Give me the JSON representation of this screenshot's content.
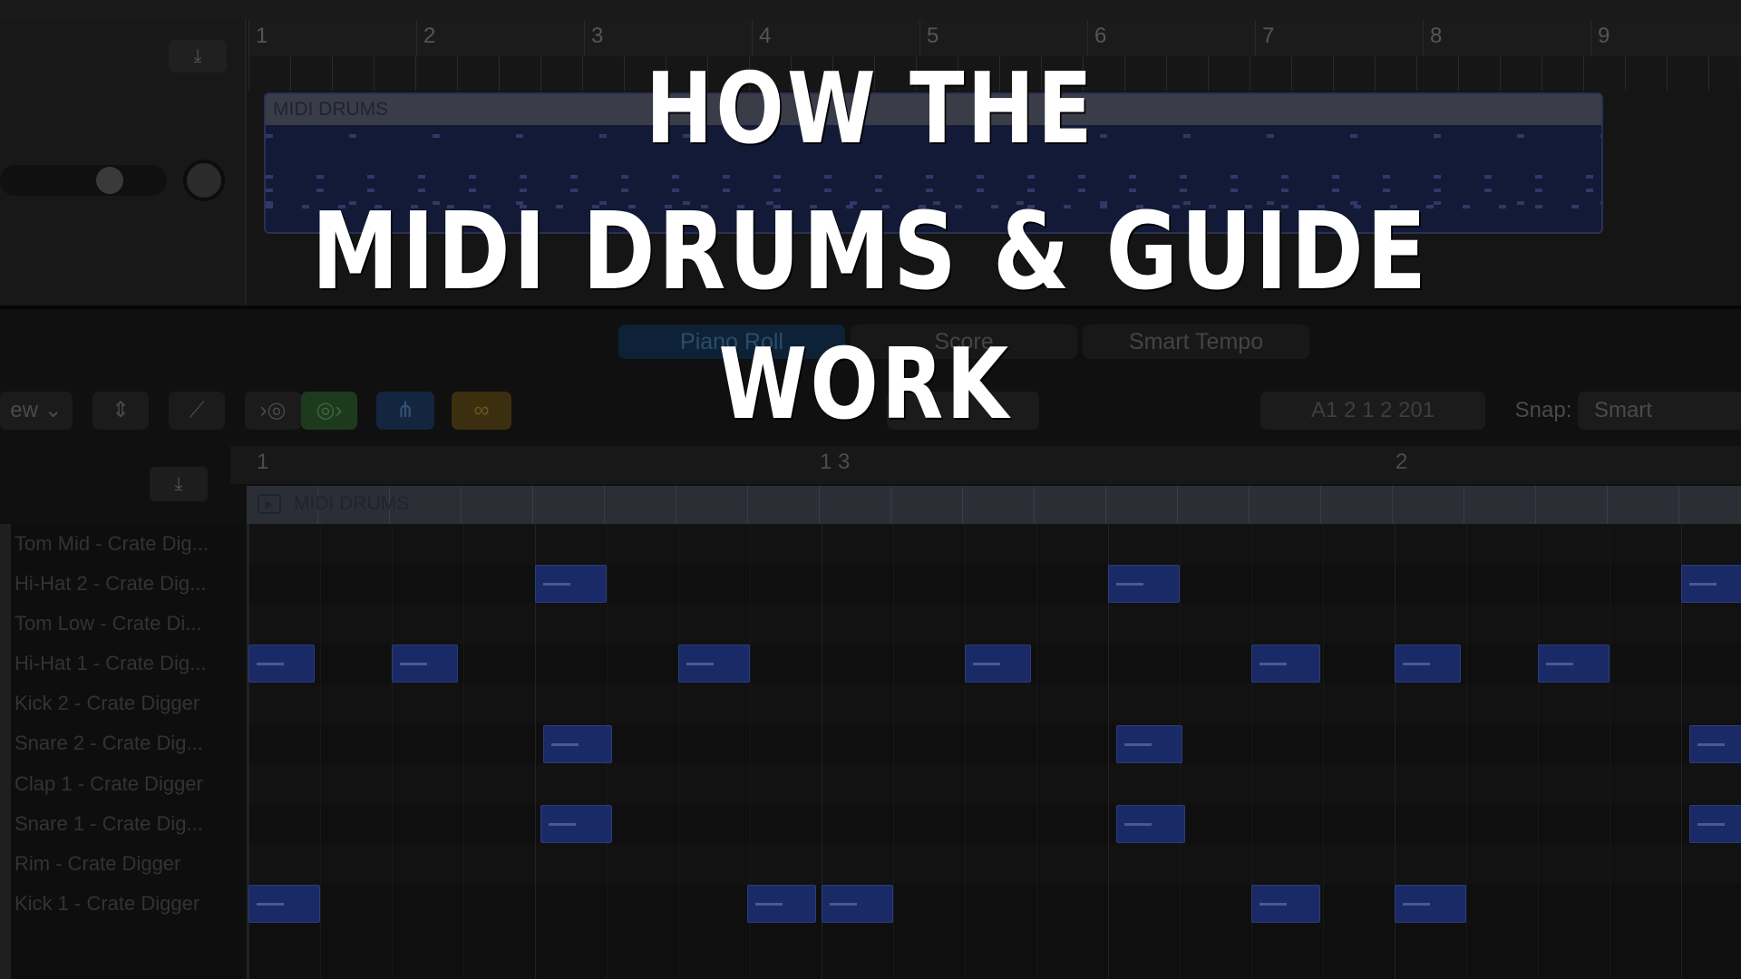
{
  "title_overlay": {
    "line1": "HOW THE",
    "line2": "MIDI DRUMS & GUIDE",
    "line3": "WORK"
  },
  "tracks_area": {
    "bar_numbers": [
      "1",
      "2",
      "3",
      "4",
      "5",
      "6",
      "7",
      "8",
      "9"
    ],
    "region_name": "MIDI DRUMS"
  },
  "editor_tabs": [
    {
      "label": "Piano Roll",
      "active": true
    },
    {
      "label": "Score",
      "active": false
    },
    {
      "label": "Smart Tempo",
      "active": false
    }
  ],
  "toolbar": {
    "view_label": "ew",
    "position_display": "A1   2 1 2 201",
    "snap_label": "Snap:",
    "snap_value": "Smart"
  },
  "editor_ruler": [
    "1",
    "1 3",
    "2"
  ],
  "editor_region_name": "MIDI DRUMS",
  "drum_rows": [
    "Tom Mid - Crate Dig...",
    "Hi-Hat 2 - Crate Dig...",
    "Tom Low - Crate Di...",
    "Hi-Hat 1 - Crate Dig...",
    "Kick 2 - Crate Digger",
    "Snare 2 - Crate Dig...",
    "Clap 1 - Crate Digger",
    "Snare 1 - Crate Dig...",
    "Rim - Crate Digger",
    "Kick 1 - Crate Digger"
  ],
  "notes_beats": [
    {
      "row": 1,
      "start": 1.0,
      "len": 0.25
    },
    {
      "row": 1,
      "start": 3.0,
      "len": 0.25
    },
    {
      "row": 1,
      "start": 5.0,
      "len": 0.25
    },
    {
      "row": 3,
      "start": 0.0,
      "len": 0.23
    },
    {
      "row": 3,
      "start": 0.5,
      "len": 0.23
    },
    {
      "row": 3,
      "start": 1.5,
      "len": 0.25
    },
    {
      "row": 3,
      "start": 2.5,
      "len": 0.23
    },
    {
      "row": 3,
      "start": 3.5,
      "len": 0.24
    },
    {
      "row": 3,
      "start": 4.0,
      "len": 0.23
    },
    {
      "row": 3,
      "start": 4.5,
      "len": 0.25
    },
    {
      "row": 5,
      "start": 1.03,
      "len": 0.24
    },
    {
      "row": 5,
      "start": 3.03,
      "len": 0.23
    },
    {
      "row": 5,
      "start": 5.03,
      "len": 0.25
    },
    {
      "row": 7,
      "start": 1.02,
      "len": 0.25
    },
    {
      "row": 7,
      "start": 3.03,
      "len": 0.24
    },
    {
      "row": 7,
      "start": 5.03,
      "len": 0.25
    },
    {
      "row": 9,
      "start": 0.0,
      "len": 0.25
    },
    {
      "row": 9,
      "start": 1.74,
      "len": 0.24
    },
    {
      "row": 9,
      "start": 2.0,
      "len": 0.25
    },
    {
      "row": 9,
      "start": 3.5,
      "len": 0.24
    },
    {
      "row": 9,
      "start": 4.0,
      "len": 0.25
    }
  ],
  "colors": {
    "note_fill": "#1a2a66",
    "region_fill": "#121a38",
    "piano_roll_tab": "#0d2236",
    "green_button": "#1e3a1e",
    "blue_button": "#14263f",
    "yellow_button": "#3b2f10"
  }
}
